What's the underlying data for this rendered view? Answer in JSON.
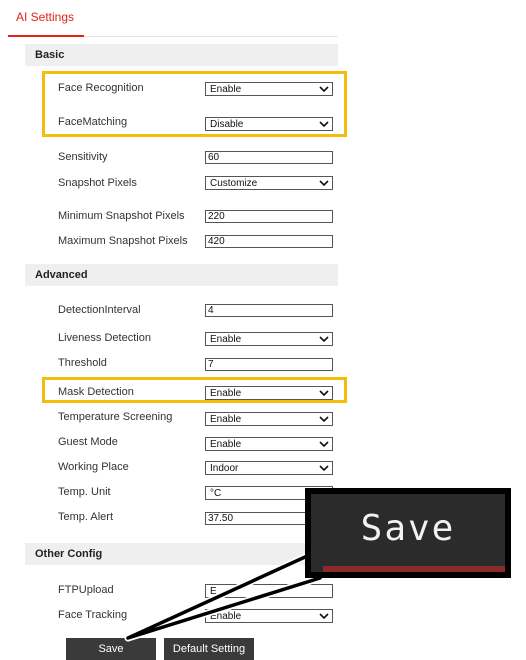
{
  "tab": {
    "title": "AI Settings"
  },
  "sections": {
    "basic": "Basic",
    "advanced": "Advanced",
    "other": "Other Config"
  },
  "basic": {
    "face_recognition": {
      "label": "Face Recognition",
      "value": "Enable"
    },
    "face_matching": {
      "label": "FaceMatching",
      "value": "Disable"
    },
    "sensitivity": {
      "label": "Sensitivity",
      "value": "60"
    },
    "snapshot_pixels": {
      "label": "Snapshot Pixels",
      "value": "Customize"
    },
    "min_snapshot": {
      "label": "Minimum Snapshot Pixels",
      "value": "220"
    },
    "max_snapshot": {
      "label": "Maximum Snapshot Pixels",
      "value": "420"
    }
  },
  "advanced": {
    "detection_interval": {
      "label": "DetectionInterval",
      "value": "4"
    },
    "liveness": {
      "label": "Liveness Detection",
      "value": "Enable"
    },
    "threshold": {
      "label": "Threshold",
      "value": "7"
    },
    "mask": {
      "label": "Mask Detection",
      "value": "Enable"
    },
    "temp_screening": {
      "label": "Temperature Screening",
      "value": "Enable"
    },
    "guest_mode": {
      "label": "Guest Mode",
      "value": "Enable"
    },
    "working_place": {
      "label": "Working Place",
      "value": "Indoor"
    },
    "temp_unit": {
      "label": "Temp. Unit",
      "value": "°C"
    },
    "temp_alert": {
      "label": "Temp. Alert",
      "value": "37.50"
    }
  },
  "other": {
    "ftp_upload": {
      "label": "FTPUpload",
      "value": "E"
    },
    "face_tracking": {
      "label": "Face Tracking",
      "value": "Enable"
    }
  },
  "buttons": {
    "save": "Save",
    "default": "Default Setting"
  },
  "callout": {
    "label": "Save"
  },
  "colors": {
    "accent": "#e2231a",
    "highlight": "#f5bd0b",
    "button": "#3a3a3a"
  },
  "icons": {
    "dropdown": "chevron-down-icon"
  }
}
